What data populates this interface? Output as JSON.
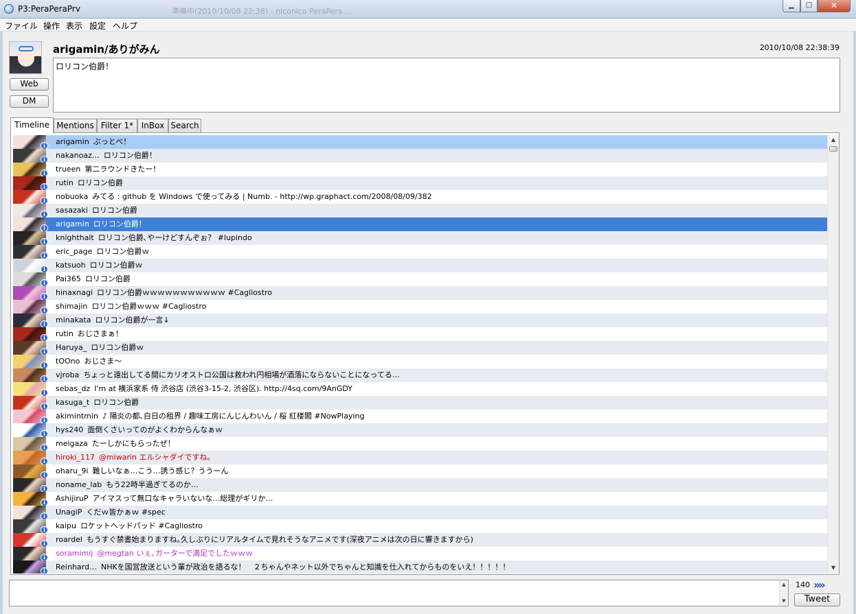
{
  "window": {
    "title": "P3:PeraPeraPrv",
    "bg_title": "準備中(2010/10/08 22:38) - niconico PeraPera ...",
    "minimize": "▁",
    "maximize": "□",
    "close": "✕"
  },
  "menu": [
    "ファイル",
    "操作",
    "表示",
    "設定",
    "ヘルプ"
  ],
  "header": {
    "username": "arigamin/ありがみん",
    "timestamp": "2010/10/08 22:38:39",
    "tweet_text": "ロリコン伯爵！",
    "web_button": "Web",
    "dm_button": "DM"
  },
  "tabs": [
    "Timeline",
    "Mentions",
    "Filter 1*",
    "InBox",
    "Search"
  ],
  "active_tab": "Timeline",
  "timeline": [
    {
      "user": "arigamin",
      "text": "ぶっとべ！",
      "state": "highlight"
    },
    {
      "user": "nakanoaz…",
      "text": "ロリコン伯爵！"
    },
    {
      "user": "trueen",
      "text": "第二ラウンドきたー！"
    },
    {
      "user": "rutin",
      "text": "ロリコン伯爵"
    },
    {
      "user": "nobuoka",
      "text": "みてる : github を Windows で使ってみる | Numb. - http://wp.graphact.com/2008/08/09/382"
    },
    {
      "user": "sasazaki",
      "text": "ロリコン伯爵"
    },
    {
      "user": "arigamin",
      "text": "ロリコン伯爵！",
      "state": "selected"
    },
    {
      "user": "knighthalt",
      "text": "ロリコン伯爵､やーけどすんぞぉ？ #lupindo"
    },
    {
      "user": "eric_page",
      "text": "ロリコン伯爵ｗ"
    },
    {
      "user": "katsuoh",
      "text": "ロリコン伯爵ｗ"
    },
    {
      "user": "Pai365",
      "text": "ロリコン伯爵"
    },
    {
      "user": "hinaxnagi",
      "text": "ロリコン伯爵ｗｗｗｗｗｗｗｗｗｗｗ #Cagliostro"
    },
    {
      "user": "shimajin",
      "text": "ロリコン伯爵ｗｗｗ #Cagliostro"
    },
    {
      "user": "minakata",
      "text": "ロリコン伯爵が一言↓"
    },
    {
      "user": "rutin",
      "text": "おじさまぁ！"
    },
    {
      "user": "Haruya_",
      "text": "ロリコン伯爵ｗ"
    },
    {
      "user": "tOOno",
      "text": "おじさま～"
    },
    {
      "user": "vjroba",
      "text": "ちょっと遠出してる間にカリオストロ公国は救われ円相場が酒落にならないことになってる…"
    },
    {
      "user": "sebas_dz",
      "text": "I'm at 横浜家系 侍 渋谷店 (渋谷3-15-2, 渋谷区). http://4sq.com/9AnGDY"
    },
    {
      "user": "kasuga_t",
      "text": "ロリコン伯爵"
    },
    {
      "user": "akimintmin",
      "text": "♪ 陽炎の都､白日の租界 / 趣味工房にんじんわいん / 桜 紅楼閣 #NowPlaying"
    },
    {
      "user": "hys240",
      "text": "面倒くさいってのがよくわからんなぁｗ"
    },
    {
      "user": "meigaza",
      "text": "たーしかにもらったぜ！"
    },
    {
      "user": "hiroki_117",
      "text": "@miwarin エルシャダイですね。",
      "color": "#cc0000"
    },
    {
      "user": "oharu_9i",
      "text": "難しいなぁ…こう…誘う感じ？ううーん"
    },
    {
      "user": "noname_lab",
      "text": "もう22時半過ぎてるのか…"
    },
    {
      "user": "AshijiruP",
      "text": "アイマスって無口なキャラいないな…総理がギリか…"
    },
    {
      "user": "UnagiP",
      "text": "くだｗ皆かぁｗ #spec"
    },
    {
      "user": "kaipu",
      "text": "ロケットヘッドパッド #Cagliostro"
    },
    {
      "user": "roardel",
      "text": "もうすぐ禁書始まりますね｡久しぶりにリアルタイムで見れそうなアニメです(深夜アニメは次の日に響きますから)"
    },
    {
      "user": "soramimij",
      "text": "@megtan いぇ､ガーターで満足でしたｗｗｗ",
      "color": "#b032c8"
    },
    {
      "user": "Reinhard…",
      "text": "NHKを国営放送という輩が政治を語るな！　２ちゃんやネット以外でちゃんと知識を仕入れてからものをいえ！！！！！"
    }
  ],
  "composer": {
    "char_count": "140",
    "tweet_button": "Tweet",
    "send_icon": "»»"
  },
  "colors": {
    "row_alt": "#e6ebf1",
    "row_highlight": "#a9cdf6",
    "row_selected": "#3e80d9",
    "info_icon": "#2b63d8"
  }
}
